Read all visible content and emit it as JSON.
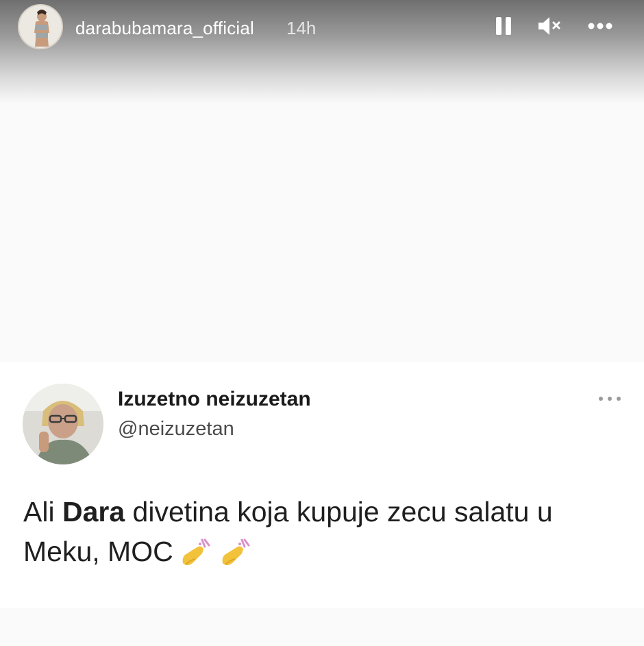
{
  "story": {
    "username": "darabubamara_official",
    "time": "14h",
    "icons": {
      "pause": "pause-icon",
      "mute": "muted-speaker-icon",
      "more": "more-options-icon"
    }
  },
  "tweet": {
    "display_name": "Izuzetno neizuzetan",
    "handle": "@neizuzetan",
    "text_before": "Ali ",
    "text_bold": "Dara",
    "text_after": " divetina koja kupuje zecu salatu u Meku, MOC",
    "emojis": [
      "nail-polish-emoji",
      "nail-polish-emoji"
    ],
    "icons": {
      "more": "more-options-icon"
    }
  },
  "colors": {
    "header_gradient_top": "#6f6f6f",
    "background": "#fafafa",
    "tweet_text": "#1f1f1f",
    "emoji_yellow": "#f2c23a",
    "emoji_pink": "#d98fc7"
  }
}
